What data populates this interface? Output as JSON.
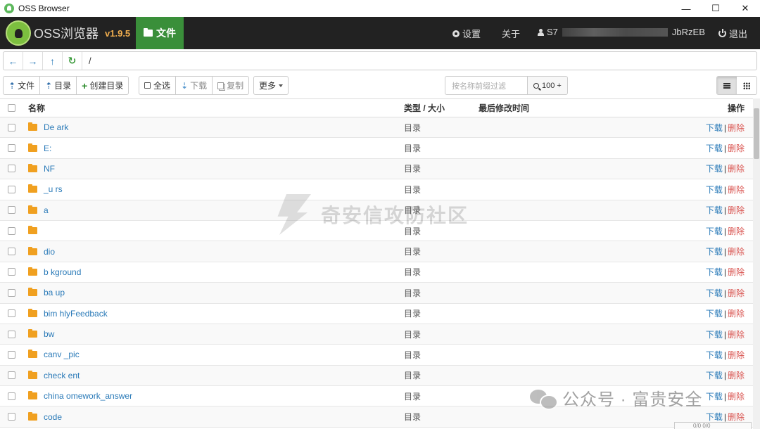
{
  "window": {
    "title": "OSS Browser",
    "minimize": "—",
    "maximize": "☐",
    "close": "✕"
  },
  "header": {
    "brand": "OSS浏览器",
    "version": "v1.9.5",
    "nav_files": "文件",
    "settings": "设置",
    "about": "关于",
    "user_prefix": "S7",
    "user_suffix": "JbRzEB",
    "logout": "退出"
  },
  "address": {
    "back": "←",
    "forward": "→",
    "up": "↑",
    "refresh": "↻",
    "path": "/"
  },
  "toolbar": {
    "upload_file": "文件",
    "upload_dir": "目录",
    "create_dir": "创建目录",
    "select_all": "全选",
    "download": "下载",
    "copy": "复制",
    "more": "更多",
    "filter_placeholder": "按名称前缀过滤",
    "search_count": "100 +"
  },
  "table": {
    "headers": {
      "name": "名称",
      "type_size": "类型 / 大小",
      "modified": "最后修改时间",
      "actions": "操作"
    },
    "action_download": "下载",
    "action_sep": "|",
    "action_delete": "删除",
    "rows": [
      {
        "name": "De ark",
        "type": "目录"
      },
      {
        "name": "E:",
        "type": "目录"
      },
      {
        "name": "NF",
        "type": "目录"
      },
      {
        "name": "_u rs",
        "type": "目录"
      },
      {
        "name": "a",
        "type": "目录"
      },
      {
        "name": "",
        "type": "目录"
      },
      {
        "name": "dio",
        "type": "目录"
      },
      {
        "name": "b kground",
        "type": "目录"
      },
      {
        "name": "ba up",
        "type": "目录"
      },
      {
        "name": "bim hlyFeedback",
        "type": "目录"
      },
      {
        "name": "bw",
        "type": "目录"
      },
      {
        "name": "canv _pic",
        "type": "目录"
      },
      {
        "name": "check ent",
        "type": "目录"
      },
      {
        "name": "china omework_answer",
        "type": "目录"
      },
      {
        "name": "code",
        "type": "目录"
      }
    ]
  },
  "watermark": {
    "main": "奇安信攻防社区",
    "secondary": "公众号 · 富贵安全"
  },
  "status": "0/0 0/0"
}
